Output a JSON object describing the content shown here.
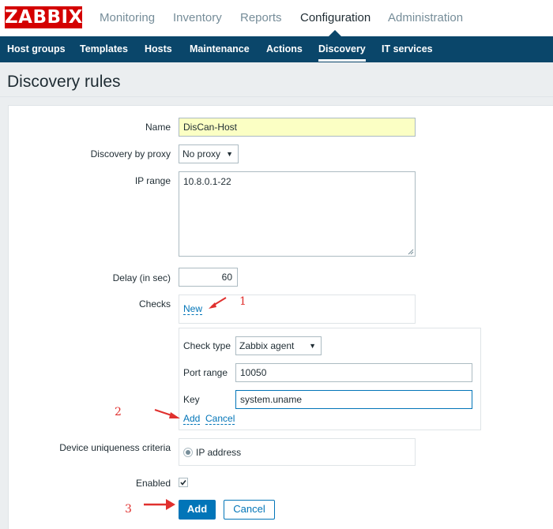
{
  "app": {
    "logo_text": "ZABBIX",
    "brand_color": "#d40000",
    "nav_color": "#0a466a",
    "accent_color": "#0275b8"
  },
  "top_nav": {
    "items": [
      "Monitoring",
      "Inventory",
      "Reports",
      "Configuration",
      "Administration"
    ],
    "active": "Configuration"
  },
  "sub_nav": {
    "items": [
      "Host groups",
      "Templates",
      "Hosts",
      "Maintenance",
      "Actions",
      "Discovery",
      "IT services"
    ],
    "active": "Discovery"
  },
  "page": {
    "title": "Discovery rules"
  },
  "form": {
    "name": {
      "label": "Name",
      "value": "DisCan-Host"
    },
    "proxy": {
      "label": "Discovery by proxy",
      "value": "No proxy"
    },
    "ip_range": {
      "label": "IP range",
      "value": "10.8.0.1-22"
    },
    "delay": {
      "label": "Delay (in sec)",
      "value": "60"
    },
    "checks": {
      "label": "Checks",
      "new_link": "New"
    },
    "check_form": {
      "check_type_label": "Check type",
      "check_type_value": "Zabbix agent",
      "port_range_label": "Port range",
      "port_range_value": "10050",
      "key_label": "Key",
      "key_value": "system.uname",
      "add_link": "Add",
      "cancel_link": "Cancel"
    },
    "uniqueness": {
      "label": "Device uniqueness criteria",
      "option": "IP address",
      "selected": true
    },
    "enabled": {
      "label": "Enabled",
      "checked": true
    },
    "add_button": "Add",
    "cancel_button": "Cancel"
  },
  "annotations": {
    "step1": "1",
    "step2": "2",
    "step3": "3",
    "color": "#e0302e"
  }
}
